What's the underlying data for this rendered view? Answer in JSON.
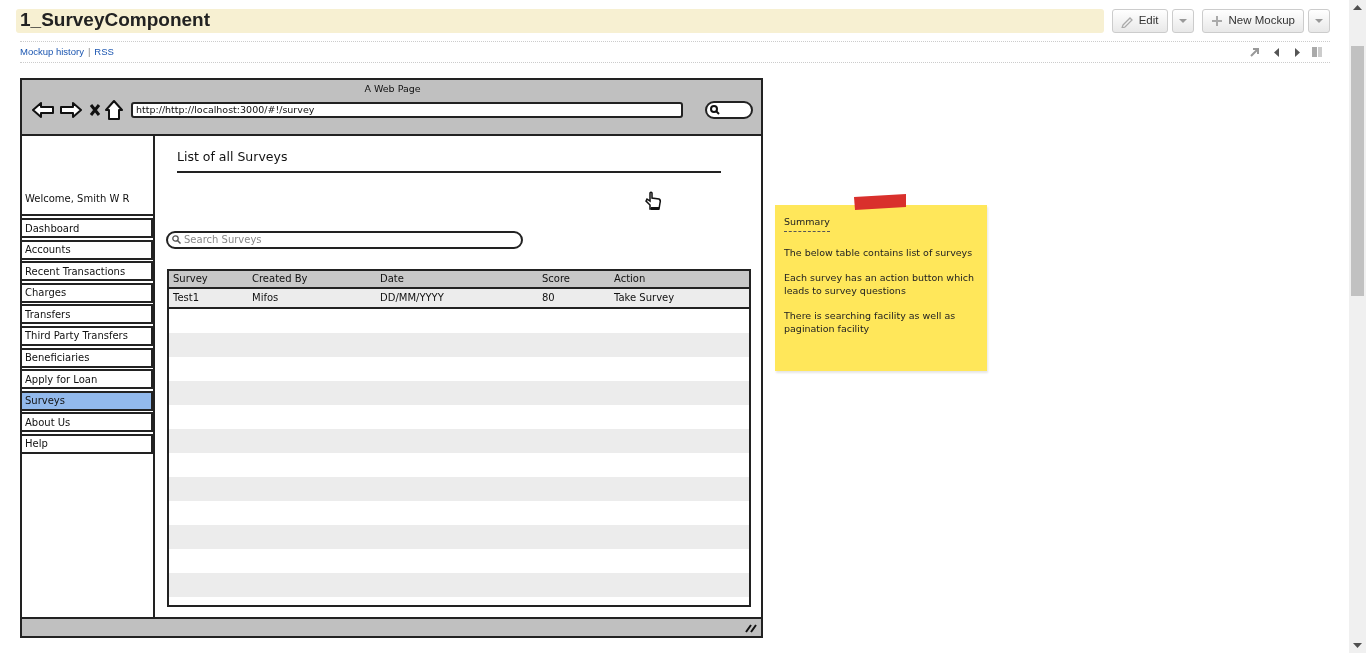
{
  "page_title": "1_SurveyComponent",
  "toolbar_buttons": [
    {
      "label": "Edit",
      "kind": "edit"
    },
    {
      "label": "New Mockup",
      "kind": "new"
    }
  ],
  "links": [
    "Mockup history",
    "RSS"
  ],
  "link_separator": "|",
  "mockup": {
    "window_title": "A Web Page",
    "url": "http://http://localhost:3000/#!/survey",
    "welcome": "Welcome, Smith W R",
    "nav": [
      {
        "label": "Dashboard",
        "selected": false
      },
      {
        "label": "Accounts",
        "selected": false
      },
      {
        "label": "Recent Transactions",
        "selected": false
      },
      {
        "label": "Charges",
        "selected": false
      },
      {
        "label": "Transfers",
        "selected": false
      },
      {
        "label": "Third Party Transfers",
        "selected": false
      },
      {
        "label": "Beneficiaries",
        "selected": false
      },
      {
        "label": "Apply for Loan",
        "selected": false
      },
      {
        "label": "Surveys",
        "selected": true
      },
      {
        "label": "About Us",
        "selected": false
      },
      {
        "label": "Help",
        "selected": false
      }
    ],
    "heading": "List of all Surveys",
    "search": {
      "placeholder": "Search Surveys"
    },
    "table": {
      "columns": [
        "Survey",
        "Created By",
        "Date",
        "Score",
        "Action"
      ],
      "rows": [
        [
          "Test1",
          "Mifos",
          "DD/MM/YYYY",
          "80",
          "Take Survey"
        ]
      ]
    }
  },
  "note": {
    "title": "Summary",
    "paragraphs": [
      "The below table contains list of surveys",
      "Each survey has an action button which leads to survey questions",
      "There is searching facility as well as pagination facility"
    ]
  }
}
